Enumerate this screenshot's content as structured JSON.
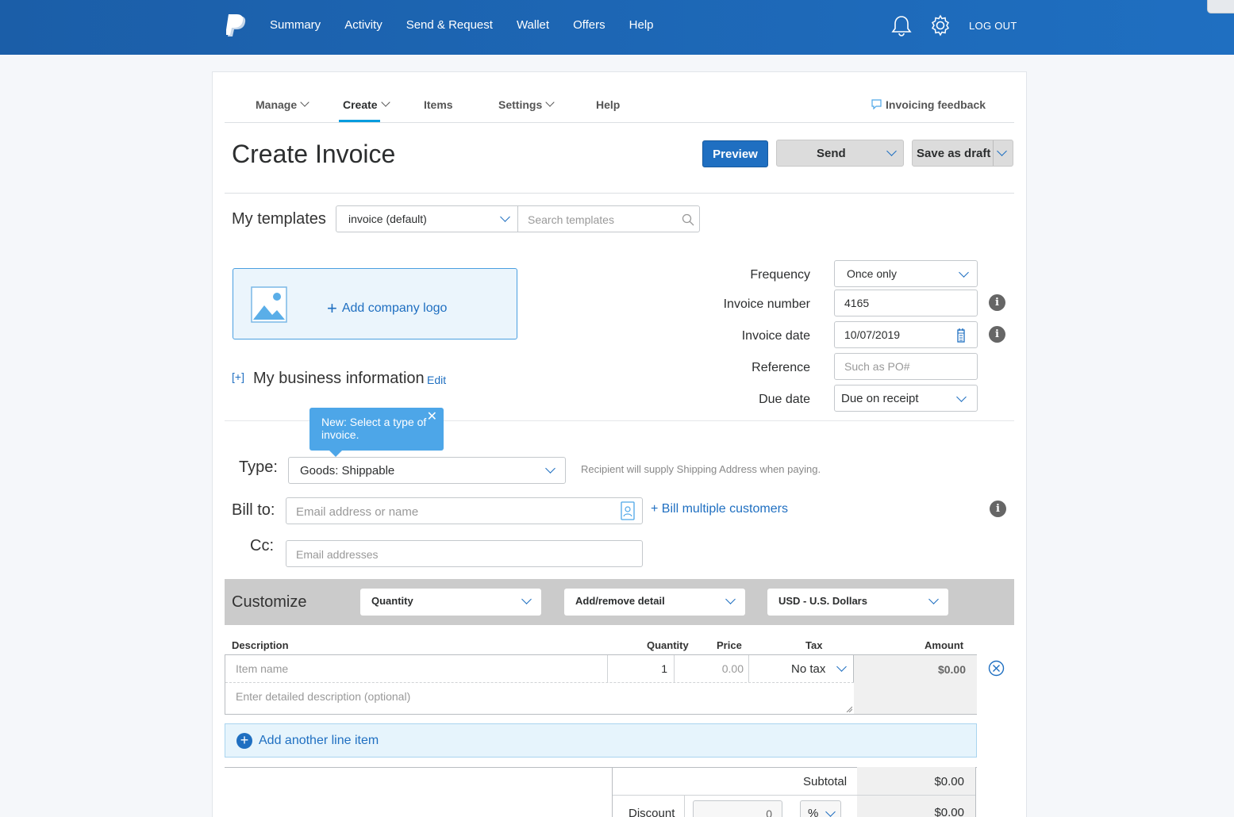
{
  "topnav": {
    "items": [
      "Summary",
      "Activity",
      "Send & Request",
      "Wallet",
      "Offers",
      "Help"
    ],
    "logout": "LOG OUT"
  },
  "subnav": {
    "manage": "Manage",
    "create": "Create",
    "items": "Items",
    "settings": "Settings",
    "help": "Help",
    "feedback": "Invoicing feedback"
  },
  "header": {
    "title": "Create Invoice",
    "preview": "Preview",
    "send": "Send",
    "save_draft": "Save as draft"
  },
  "templates": {
    "label": "My templates",
    "selected": "invoice (default)",
    "search_placeholder": "Search templates"
  },
  "logo": {
    "add_label": "Add company logo"
  },
  "business": {
    "toggle": "[+]",
    "title": "My business information",
    "edit": "Edit"
  },
  "meta": {
    "frequency_label": "Frequency",
    "frequency_value": "Once only",
    "invoice_number_label": "Invoice number",
    "invoice_number_value": "4165",
    "invoice_date_label": "Invoice date",
    "invoice_date_value": "10/07/2019",
    "reference_label": "Reference",
    "reference_placeholder": "Such as PO#",
    "due_date_label": "Due date",
    "due_date_value": "Due on receipt"
  },
  "tooltip": {
    "text": "New: Select a type of invoice."
  },
  "type": {
    "label": "Type:",
    "value": "Goods: Shippable",
    "hint": "Recipient will supply Shipping Address when paying."
  },
  "bill": {
    "label": "Bill to:",
    "placeholder": "Email address or name",
    "multi": "+ Bill multiple customers",
    "cc_label": "Cc:",
    "cc_placeholder": "Email addresses"
  },
  "customize": {
    "title": "Customize",
    "quantity": "Quantity",
    "detail": "Add/remove detail",
    "currency": "USD - U.S. Dollars"
  },
  "table": {
    "headers": {
      "description": "Description",
      "quantity": "Quantity",
      "price": "Price",
      "tax": "Tax",
      "amount": "Amount"
    },
    "item_placeholder": "Item name",
    "qty_value": "1",
    "price_placeholder": "0.00",
    "tax_value": "No tax",
    "amount_value": "$0.00",
    "desc_placeholder": "Enter detailed description (optional)",
    "add_line": "Add another line item"
  },
  "totals": {
    "subtotal_label": "Subtotal",
    "subtotal_value": "$0.00",
    "discount_label": "Discount",
    "discount_input": "0",
    "discount_unit": "%",
    "discount_value": "$0.00"
  },
  "colors": {
    "brand": "#1f6fc1",
    "accent": "#009cde",
    "tooltip": "#4da6e8"
  }
}
